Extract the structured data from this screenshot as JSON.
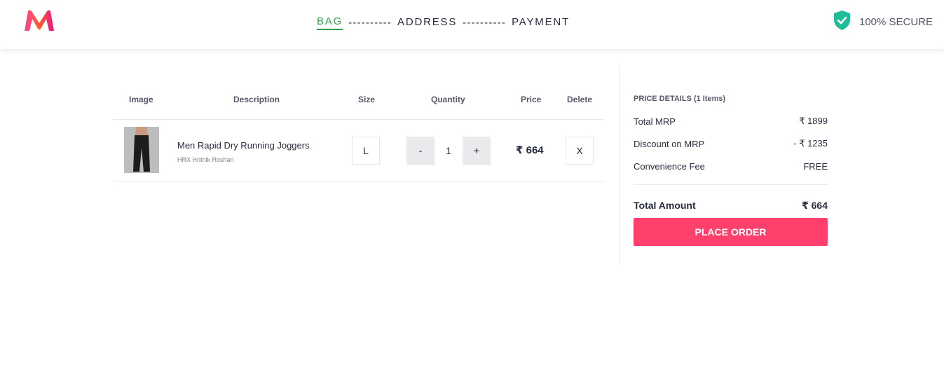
{
  "header": {
    "steps": {
      "bag": "BAG",
      "sep1": "----------",
      "address": "ADDRESS",
      "sep2": "----------",
      "payment": "PAYMENT"
    },
    "secure_label": "100% SECURE",
    "active_color": "#2e9e42"
  },
  "cart": {
    "headers": {
      "image": "Image",
      "description": "Description",
      "size": "Size",
      "quantity": "Quantity",
      "price": "Price",
      "delete": "Delete"
    },
    "items": [
      {
        "name": "Men Rapid Dry Running Joggers",
        "brand": "HRX Hrithik Roshan",
        "size": "L",
        "quantity": "1",
        "minus": "-",
        "plus": "+",
        "price": "₹ 664",
        "delete": "X"
      }
    ]
  },
  "summary": {
    "title": "PRICE DETAILS (1 Items)",
    "lines": [
      {
        "label": "Total MRP",
        "value": "₹ 1899"
      },
      {
        "label": "Discount on MRP",
        "value": "- ₹ 1235"
      },
      {
        "label": "Convenience Fee",
        "value": "FREE"
      }
    ],
    "total_label": "Total Amount",
    "total_value": "₹ 664",
    "button_label": "PLACE ORDER",
    "button_color": "#ff3f6c"
  }
}
